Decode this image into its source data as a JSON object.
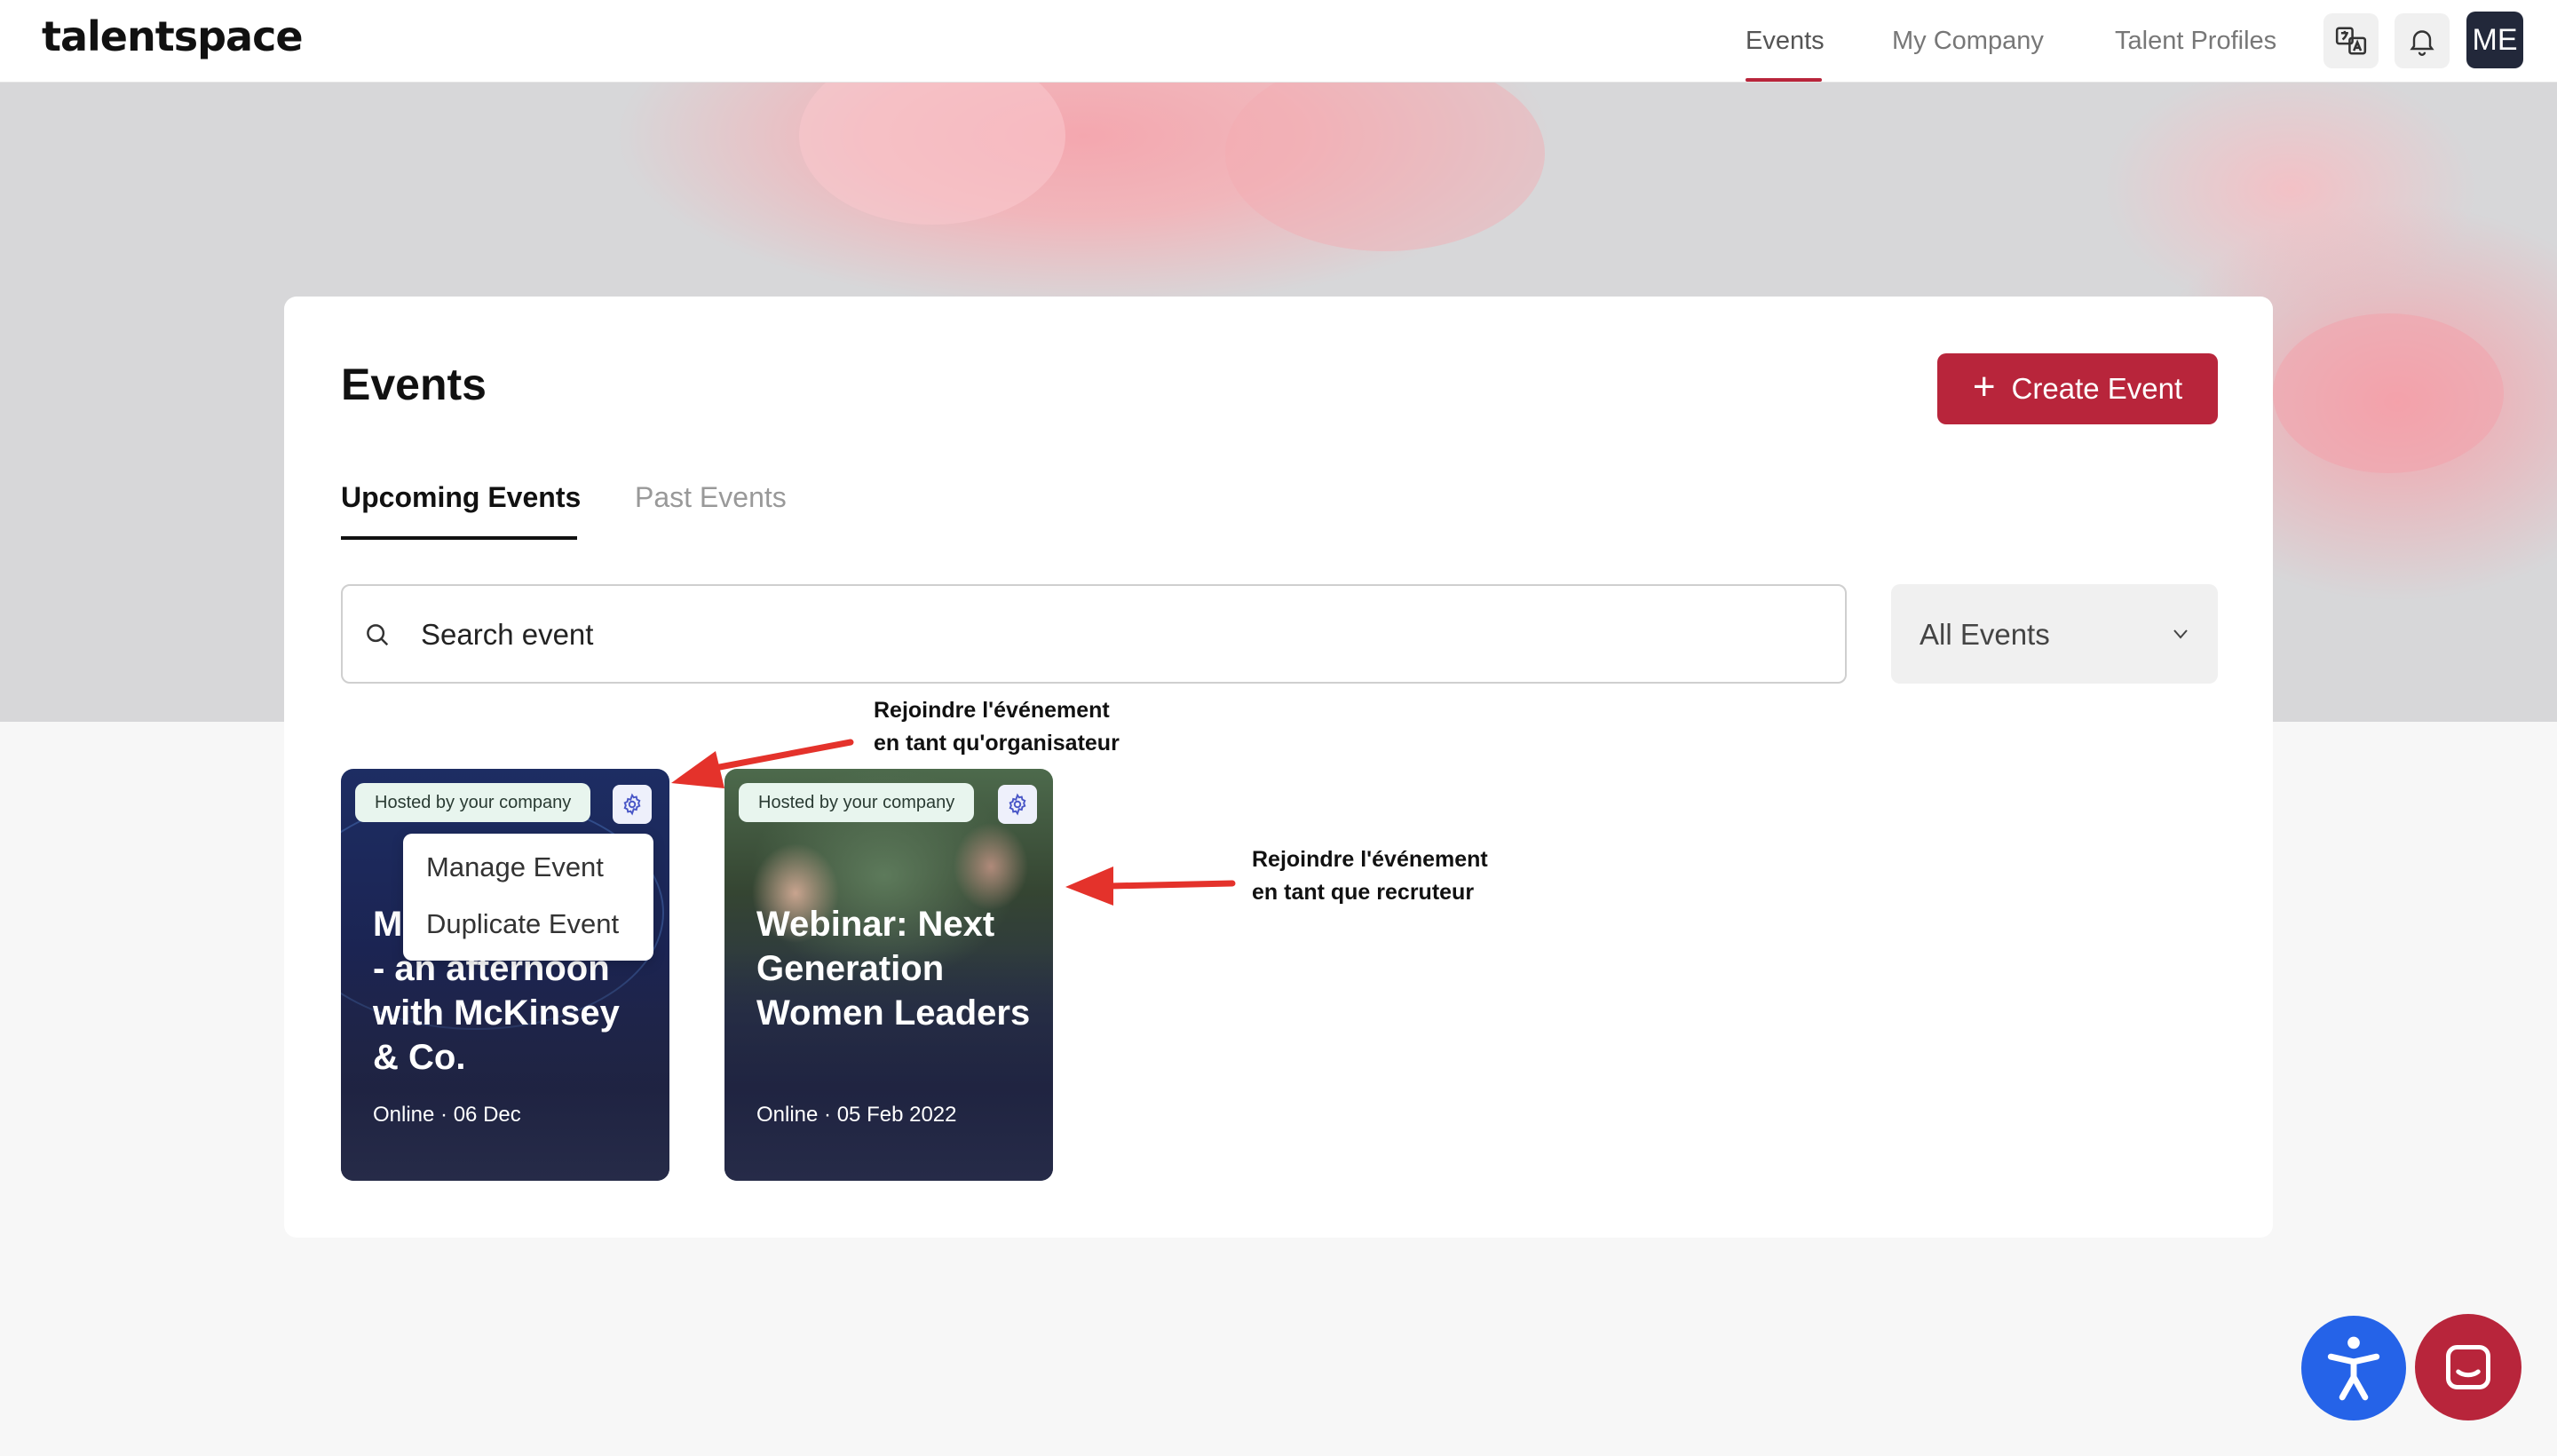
{
  "app": {
    "logo": "talentspace"
  },
  "nav": {
    "items": [
      {
        "label": "Events",
        "active": true
      },
      {
        "label": "My Company",
        "active": false
      },
      {
        "label": "Talent Profiles",
        "active": false
      }
    ],
    "translate_icon": "translate-icon",
    "bell_icon": "bell-icon",
    "avatar_initials": "ME"
  },
  "page": {
    "title": "Events",
    "create_label": "Create Event",
    "tabs": [
      {
        "label": "Upcoming Events",
        "active": true
      },
      {
        "label": "Past Events",
        "active": false
      }
    ],
    "search_text": "Search event",
    "filter_value": "All Events"
  },
  "events": [
    {
      "badge": "Hosted by your company",
      "title_visible": "M\n- an afternoon\nwith McKinsey\n& Co.",
      "meta": "Online · 06 Dec"
    },
    {
      "badge": "Hosted by your company",
      "title": "Webinar: Next Generation Women Leaders",
      "meta": "Online · 05 Feb 2022"
    }
  ],
  "context_menu": {
    "items": [
      "Manage Event",
      "Duplicate Event"
    ]
  },
  "annotations": {
    "organizer_line1": "Rejoindre l'événement",
    "organizer_line2": "en tant qu'organisateur",
    "recruiter_line1": "Rejoindre l'événement",
    "recruiter_line2": "en tant que recruteur"
  },
  "colors": {
    "brand": "#b8253b",
    "accessibility": "#2563e8",
    "arrow": "#e4322b",
    "badge_bg": "#e8f5ee"
  }
}
